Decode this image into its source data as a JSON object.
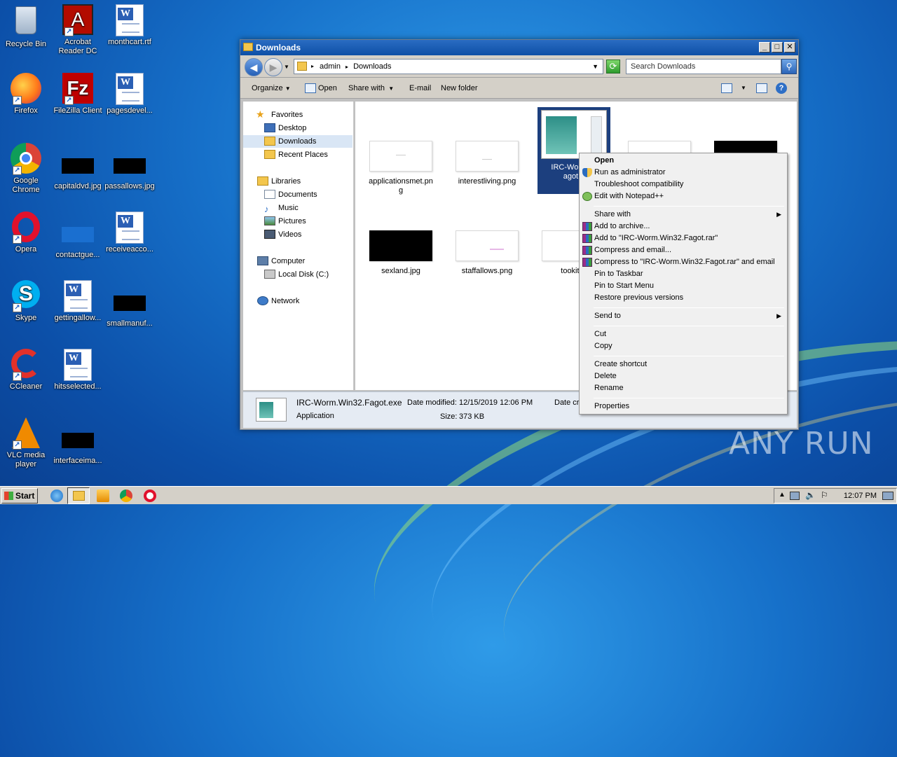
{
  "desktop": {
    "icons": [
      {
        "label": "Recycle Bin",
        "icon": "recycle-bin-icon"
      },
      {
        "label": "Acrobat Reader DC",
        "icon": "acrobat-icon"
      },
      {
        "label": "monthcart.rtf",
        "icon": "word-document-icon"
      },
      {
        "label": "Firefox",
        "icon": "firefox-icon"
      },
      {
        "label": "FileZilla Client",
        "icon": "filezilla-icon"
      },
      {
        "label": "pagesdevel...",
        "icon": "word-document-icon"
      },
      {
        "label": "Google Chrome",
        "icon": "chrome-icon"
      },
      {
        "label": "capitaldvd.jpg",
        "icon": "image-thumbnail"
      },
      {
        "label": "passallows.jpg",
        "icon": "image-thumbnail"
      },
      {
        "label": "Opera",
        "icon": "opera-icon"
      },
      {
        "label": "contactgue...",
        "icon": "image-thumbnail"
      },
      {
        "label": "receiveacco...",
        "icon": "word-document-icon"
      },
      {
        "label": "Skype",
        "icon": "skype-icon"
      },
      {
        "label": "gettingallow...",
        "icon": "word-document-icon"
      },
      {
        "label": "smallmanuf...",
        "icon": "image-thumbnail"
      },
      {
        "label": "CCleaner",
        "icon": "ccleaner-icon"
      },
      {
        "label": "hitsselected...",
        "icon": "word-document-icon"
      },
      {
        "label": "VLC media player",
        "icon": "vlc-icon"
      },
      {
        "label": "interfaceima...",
        "icon": "image-thumbnail"
      }
    ]
  },
  "window": {
    "title": "Downloads",
    "controls": {
      "minimize": "_",
      "maximize": "□",
      "close": "✕"
    },
    "address": {
      "segments": [
        "admin",
        "Downloads"
      ],
      "separator": "▸"
    },
    "search_placeholder": "Search Downloads",
    "toolbar": {
      "organize": "Organize",
      "open": "Open",
      "share_with": "Share with",
      "email": "E-mail",
      "new_folder": "New folder",
      "help": "?"
    },
    "nav": {
      "favorites": "Favorites",
      "desktop": "Desktop",
      "downloads": "Downloads",
      "recent": "Recent Places",
      "libraries": "Libraries",
      "documents": "Documents",
      "music": "Music",
      "pictures": "Pictures",
      "videos": "Videos",
      "computer": "Computer",
      "local_disk": "Local Disk (C:)",
      "network": "Network"
    },
    "files": [
      {
        "name": "applicationsmet.png",
        "name_line1": "applicationsmet.pn",
        "name_line2": "g",
        "thumb": "white"
      },
      {
        "name": "interestliving.png",
        "thumb": "white"
      },
      {
        "name": "IRC-Worm.Win32.Fagot.exe",
        "name_line1": "IRC-Worm.W",
        "name_line2": "agot.e",
        "thumb": "exe",
        "selected": true
      },
      {
        "name": "",
        "thumb": "white"
      },
      {
        "name": "",
        "thumb": "black"
      },
      {
        "name": "sexland.jpg",
        "thumb": "black"
      },
      {
        "name": "staffallows.png",
        "thumb": "white"
      },
      {
        "name": "tookit.p",
        "thumb": "white"
      }
    ],
    "details": {
      "filename": "IRC-Worm.Win32.Fagot.exe",
      "type": "Application",
      "date_modified_label": "Date modified:",
      "date_modified": "12/15/2019 12:06 PM",
      "size_label": "Size:",
      "size": "373 KB",
      "date_created_label": "Date cr"
    }
  },
  "context_menu": {
    "items": [
      {
        "label": "Open",
        "bold": true
      },
      {
        "label": "Run as administrator",
        "icon": "uac-shield-icon"
      },
      {
        "label": "Troubleshoot compatibility"
      },
      {
        "label": "Edit with Notepad++",
        "icon": "notepadpp-icon"
      },
      {
        "label": "Share with",
        "submenu": true
      },
      {
        "label": "Add to archive...",
        "icon": "winrar-icon"
      },
      {
        "label": "Add to \"IRC-Worm.Win32.Fagot.rar\"",
        "icon": "winrar-icon"
      },
      {
        "label": "Compress and email...",
        "icon": "winrar-icon"
      },
      {
        "label": "Compress to \"IRC-Worm.Win32.Fagot.rar\" and email",
        "icon": "winrar-icon"
      },
      {
        "label": "Pin to Taskbar"
      },
      {
        "label": "Pin to Start Menu"
      },
      {
        "label": "Restore previous versions"
      },
      {
        "label": "Send to",
        "submenu": true
      },
      {
        "label": "Cut"
      },
      {
        "label": "Copy"
      },
      {
        "label": "Create shortcut"
      },
      {
        "label": "Delete"
      },
      {
        "label": "Rename"
      },
      {
        "label": "Properties"
      }
    ]
  },
  "taskbar": {
    "start_label": "Start",
    "clock": "12:07 PM",
    "quicklaunch": [
      "ie-icon",
      "explorer-icon",
      "media-player-icon",
      "chrome-icon",
      "opera-icon"
    ]
  },
  "watermark": "ANY RUN",
  "colors": {
    "selection": "#1c3f7e",
    "titlebar": "#0d4fa6",
    "desktop": "#1670c9"
  }
}
